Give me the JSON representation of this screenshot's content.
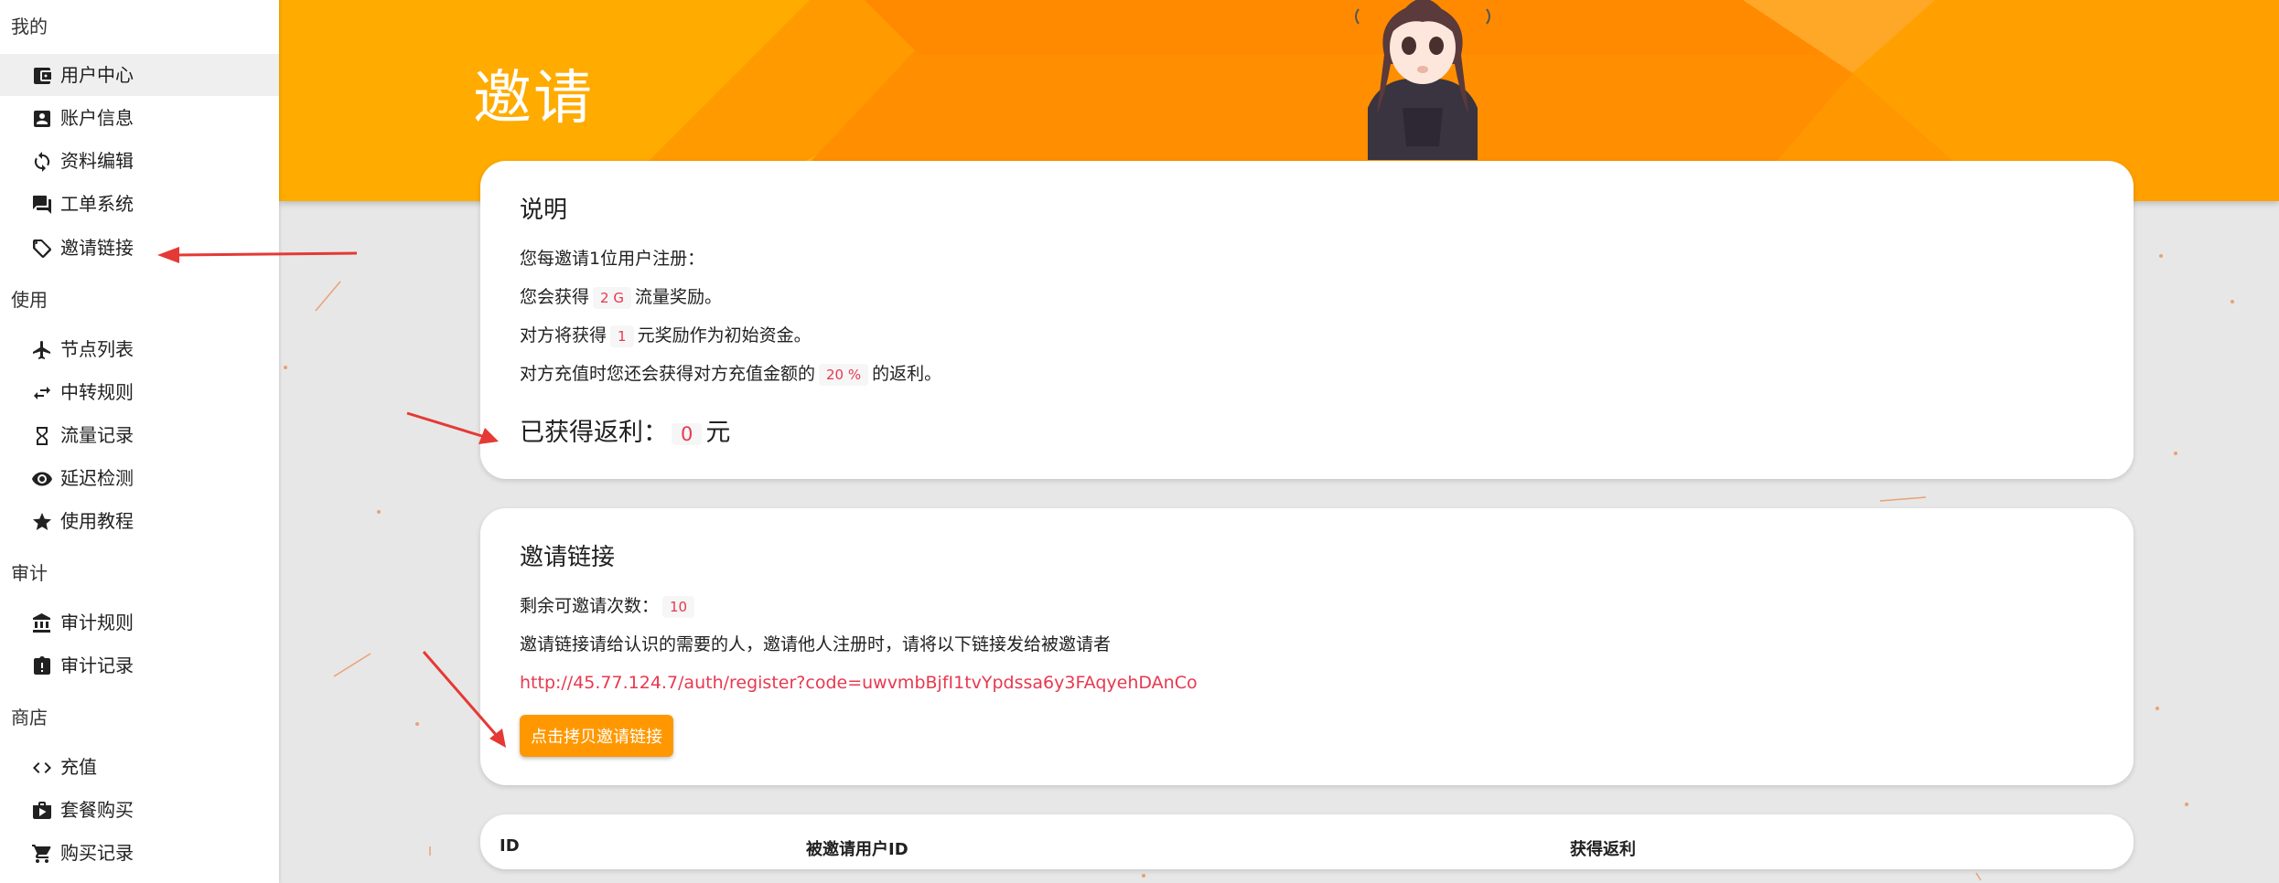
{
  "sidebar": {
    "groups": [
      {
        "title": "我的",
        "items": [
          {
            "label": "用户中心",
            "icon": "wallet-icon",
            "active": true
          },
          {
            "label": "账户信息",
            "icon": "account-box-icon"
          },
          {
            "label": "资料编辑",
            "icon": "sync-icon"
          },
          {
            "label": "工单系统",
            "icon": "forum-icon"
          },
          {
            "label": "邀请链接",
            "icon": "tag-icon"
          }
        ]
      },
      {
        "title": "使用",
        "items": [
          {
            "label": "节点列表",
            "icon": "airplane-icon"
          },
          {
            "label": "中转规则",
            "icon": "transfer-icon"
          },
          {
            "label": "流量记录",
            "icon": "hourglass-icon"
          },
          {
            "label": "延迟检测",
            "icon": "eye-icon"
          },
          {
            "label": "使用教程",
            "icon": "star-icon"
          }
        ]
      },
      {
        "title": "审计",
        "items": [
          {
            "label": "审计规则",
            "icon": "bank-icon"
          },
          {
            "label": "审计记录",
            "icon": "alert-icon"
          }
        ]
      },
      {
        "title": "商店",
        "items": [
          {
            "label": "充值",
            "icon": "code-icon"
          },
          {
            "label": "套餐购买",
            "icon": "shop-icon"
          },
          {
            "label": "购买记录",
            "icon": "cart-icon"
          }
        ]
      }
    ]
  },
  "header": {
    "title": "邀请"
  },
  "explain": {
    "title": "说明",
    "line1": "您每邀请1位用户注册：",
    "line2_pre": "您会获得",
    "line2_chip": "2 G",
    "line2_post": "流量奖励。",
    "line3_pre": "对方将获得",
    "line3_chip": "1",
    "line3_post": "元奖励作为初始资金。",
    "line4_pre": "对方充值时您还会获得对方充值金额的",
    "line4_chip": "20 %",
    "line4_post": "的返利。",
    "earned_label": "已获得返利：",
    "earned_value": "0",
    "earned_unit": "元"
  },
  "invite": {
    "title": "邀请链接",
    "remaining_label": "剩余可邀请次数：",
    "remaining_value": "10",
    "desc": "邀请链接请给认识的需要的人，邀请他人注册时，请将以下链接发给被邀请者",
    "link": "http://45.77.124.7/auth/register?code=uwvmbBjfI1tvYpdssa6y3FAqyehDAnCo",
    "copy_button": "点击拷贝邀请链接"
  },
  "table": {
    "headers": [
      "ID",
      "被邀请用户ID",
      "获得返利"
    ]
  },
  "colors": {
    "accent": "#ff9800",
    "header_orange": "#ffa000",
    "highlight": "#e8384f",
    "arrow": "#e53935"
  }
}
